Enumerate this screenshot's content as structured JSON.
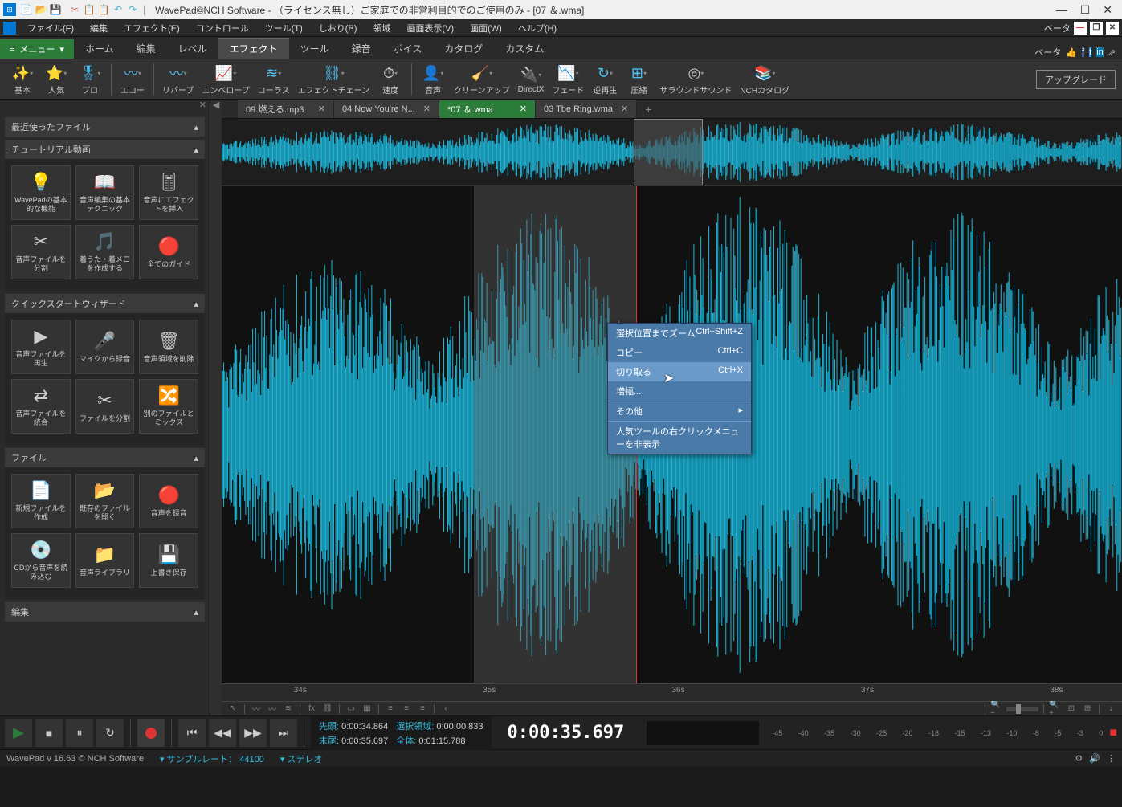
{
  "titlebar": {
    "app": "WavePad©NCH Software - ",
    "license": "（ライセンス無し）ご家庭での非営利目的でのご使用のみ",
    "file": " - [07 ＆.wma]"
  },
  "menubar": {
    "items": [
      "ファイル(F)",
      "編集",
      "エフェクト(E)",
      "コントロール",
      "ツール(T)",
      "しおり(B)",
      "領域",
      "画面表示(V)",
      "画面(W)",
      "ヘルプ(H)"
    ],
    "beta": "ベータ"
  },
  "ribbon": {
    "menu_button": "メニュー",
    "tabs": [
      "ホーム",
      "編集",
      "レベル",
      "エフェクト",
      "ツール",
      "録音",
      "ボイス",
      "カタログ",
      "カスタム"
    ],
    "active_index": 3,
    "beta": "ベータ"
  },
  "toolbar": {
    "items": [
      {
        "label": "基本",
        "icon": "✨",
        "color": "#ffeb3b"
      },
      {
        "label": "人気",
        "icon": "⭐",
        "color": "#ff9800"
      },
      {
        "label": "プロ",
        "icon": "🎖",
        "color": "#4fc3f7"
      },
      {
        "label": "エコー",
        "icon": "〰",
        "color": "#4fc3f7"
      },
      {
        "label": "リバーブ",
        "icon": "〰",
        "color": "#4fc3f7"
      },
      {
        "label": "エンベロープ",
        "icon": "📈",
        "color": "#4fc3f7"
      },
      {
        "label": "コーラス",
        "icon": "≋",
        "color": "#4fc3f7"
      },
      {
        "label": "エフェクトチェーン",
        "icon": "⛓",
        "color": "#4fc3f7"
      },
      {
        "label": "速度",
        "icon": "⏱",
        "color": "#ccc"
      },
      {
        "label": "音声",
        "icon": "👤",
        "color": "#ccc"
      },
      {
        "label": "クリーンアップ",
        "icon": "🧹",
        "color": "#ccc"
      },
      {
        "label": "DirectX",
        "icon": "🔌",
        "color": "#4fc3f7"
      },
      {
        "label": "フェード",
        "icon": "📉",
        "color": "#4fc3f7"
      },
      {
        "label": "逆再生",
        "icon": "↻",
        "color": "#4fc3f7"
      },
      {
        "label": "圧縮",
        "icon": "⊞",
        "color": "#4fc3f7"
      },
      {
        "label": "サラウンドサウンド",
        "icon": "◎",
        "color": "#ccc"
      },
      {
        "label": "NCHカタログ",
        "icon": "📚",
        "color": "#ccc"
      }
    ],
    "upgrade": "アップグレード"
  },
  "sidebar": {
    "panels": [
      {
        "title": "最近使ったファイル",
        "tiles": []
      },
      {
        "title": "チュートリアル動画",
        "tiles": [
          [
            {
              "label": "WavePadの基本的な機能",
              "icon": "💡"
            },
            {
              "label": "音声編集の基本テクニック",
              "icon": "📖"
            },
            {
              "label": "音声にエフェクトを挿入",
              "icon": "🎚"
            }
          ],
          [
            {
              "label": "音声ファイルを分割",
              "icon": "✂"
            },
            {
              "label": "着うた・着メロを作成する",
              "icon": "🎵"
            },
            {
              "label": "全てのガイド",
              "icon": "🔴"
            }
          ]
        ]
      },
      {
        "title": "クイックスタートウィザード",
        "tiles": [
          [
            {
              "label": "音声ファイルを再生",
              "icon": "▶"
            },
            {
              "label": "マイクから録音",
              "icon": "🎤"
            },
            {
              "label": "音声領域を削除",
              "icon": "🗑"
            }
          ],
          [
            {
              "label": "音声ファイルを統合",
              "icon": "⇄"
            },
            {
              "label": "ファイルを分割",
              "icon": "✂"
            },
            {
              "label": "別のファイルとミックス",
              "icon": "🔀"
            }
          ]
        ]
      },
      {
        "title": "ファイル",
        "tiles": [
          [
            {
              "label": "新規ファイルを作成",
              "icon": "📄"
            },
            {
              "label": "既存のファイルを開く",
              "icon": "📂"
            },
            {
              "label": "音声を録音",
              "icon": "🔴"
            }
          ],
          [
            {
              "label": "CDから音声を読み込む",
              "icon": "💿"
            },
            {
              "label": "音声ライブラリ",
              "icon": "📁"
            },
            {
              "label": "上書き保存",
              "icon": "💾"
            }
          ]
        ]
      },
      {
        "title": "編集",
        "tiles": []
      }
    ]
  },
  "file_tabs": {
    "items": [
      {
        "label": "09.燃える.mp3",
        "active": false
      },
      {
        "label": "04 Now  You're  N...",
        "active": false
      },
      {
        "label": "*07 ＆.wma",
        "active": true
      },
      {
        "label": "03 Tbe Ring.wma",
        "active": false
      }
    ]
  },
  "timeline": {
    "marks": [
      "34s",
      "35s",
      "36s",
      "37s",
      "38s"
    ]
  },
  "context_menu": {
    "items": [
      {
        "label": "選択位置までズーム",
        "shortcut": "Ctrl+Shift+Z"
      },
      {
        "label": "コピー",
        "shortcut": "Ctrl+C"
      },
      {
        "label": "切り取る",
        "shortcut": "Ctrl+X",
        "hover": true
      },
      {
        "label": "増幅...",
        "shortcut": ""
      },
      {
        "label": "その他",
        "shortcut": "▸"
      },
      {
        "label": "人気ツールの右クリックメニューを非表示",
        "shortcut": ""
      }
    ]
  },
  "transport": {
    "time_info": {
      "start_label": "先頭:",
      "start_val": "0:00:34.864",
      "sel_label": "選択領域:",
      "sel_val": "0:00:00.833",
      "end_label": "末尾:",
      "end_val": "0:00:35.697",
      "total_label": "全体:",
      "total_val": "0:01:15.788"
    },
    "big_time": "0:00:35.697",
    "db_marks": [
      "-45",
      "-40",
      "-35",
      "-30",
      "-25",
      "-20",
      "-18",
      "-15",
      "-13",
      "-10",
      "-8",
      "-5",
      "-3",
      "0"
    ]
  },
  "statusbar": {
    "version": "WavePad v 16.63 © NCH Software",
    "sample_rate_label": "サンプルレート：",
    "sample_rate": "44100",
    "channels_label": "ステレオ"
  },
  "waveform_color": "#1bb5d8",
  "selection": {
    "overview_left_pct": 45.8,
    "overview_width_pct": 7.6,
    "main_left_pct": 28,
    "main_width_pct": 18
  },
  "playhead_pct": 46
}
